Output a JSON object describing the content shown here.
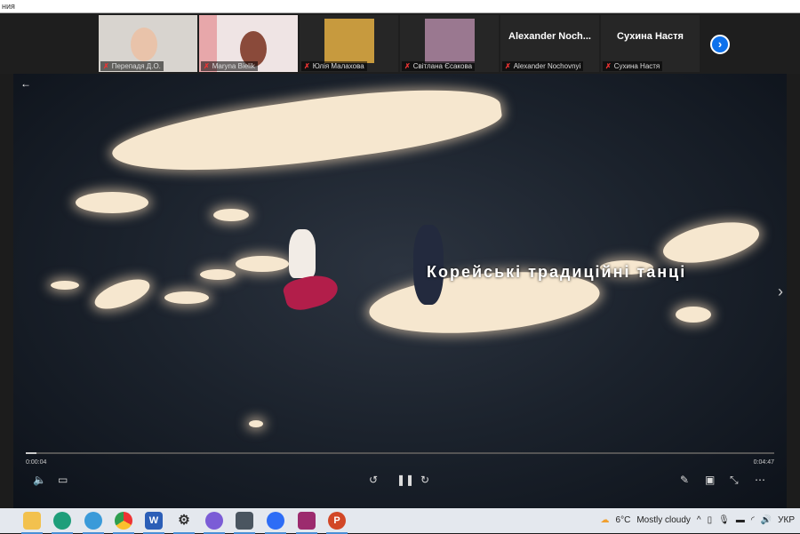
{
  "window": {
    "title": "ния"
  },
  "participants": [
    {
      "name": "Перепадя Д.О.",
      "video": "camera",
      "bg": "#d8d4cf"
    },
    {
      "name": "Maryna Bielik",
      "video": "camera",
      "bg": "#e6d8d8"
    },
    {
      "name": "Юлія Малахова",
      "video": "avatar",
      "bg": "#c79a3e"
    },
    {
      "name": "Світлана Єсакова",
      "video": "avatar",
      "bg": "#9a7890"
    },
    {
      "name": "Alexander Nochovnyi",
      "display": "Alexander  Noch..."
    },
    {
      "name": "Сухина Настя",
      "display": "Сухина Настя"
    }
  ],
  "video": {
    "title": "Корейські традиційні танці",
    "current_time": "0:00:04",
    "duration": "0:04:47",
    "progress": 1.4
  },
  "weather": {
    "temp": "6°C",
    "condition": "Mostly cloudy"
  },
  "tray": {
    "lang": "УКР"
  }
}
